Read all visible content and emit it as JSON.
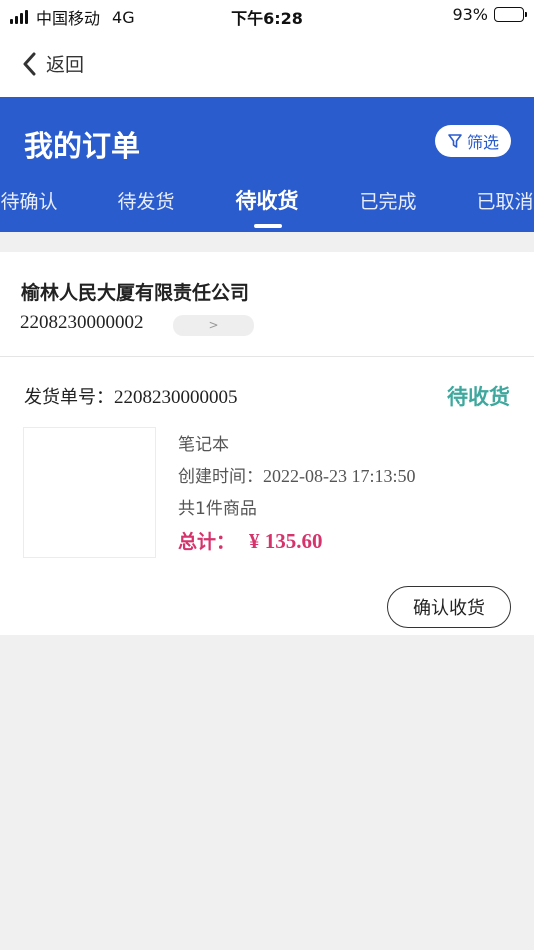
{
  "status_bar": {
    "carrier": "中国移动",
    "network": "4G",
    "time": "下午6:28",
    "battery_text": "93%",
    "battery_level": 0.93
  },
  "nav": {
    "back_label": "返回"
  },
  "header": {
    "title": "我的订单",
    "filter_label": "筛选",
    "accent_color": "#2a5ccd"
  },
  "tabs": [
    {
      "label": "待确认",
      "active": false
    },
    {
      "label": "待发货",
      "active": false
    },
    {
      "label": "待收货",
      "active": true
    },
    {
      "label": "已完成",
      "active": false
    },
    {
      "label": "已取消",
      "active": false
    }
  ],
  "order": {
    "company": "榆林人民大厦有限责任公司",
    "order_number": "2208230000002",
    "arrow": ">",
    "shipping_label": "发货单号：",
    "shipping_number": "2208230000005",
    "status": "待收货",
    "status_color": "#3fa89e",
    "product_name": "笔记本",
    "created_label": "创建时间：",
    "created_value": "2022-08-23 17:13:50",
    "item_count": "共1件商品",
    "total_label": "总计：",
    "total_amount": "¥ 135.60",
    "total_color": "#d6336c",
    "confirm_label": "确认收货"
  }
}
